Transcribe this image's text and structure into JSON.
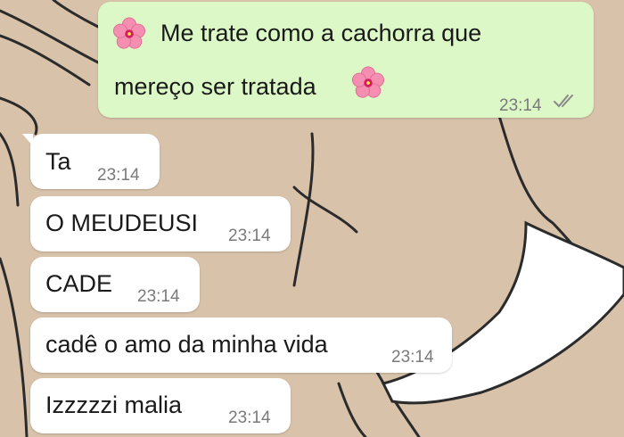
{
  "messages": [
    {
      "direction": "outgoing",
      "line1": "Me trate como a cachorra que",
      "line2": "mereço ser tratada",
      "time": "23:14",
      "status": "read-double-check-icon",
      "decoration": "cherry-blossom-icon"
    },
    {
      "direction": "incoming",
      "text": "Ta",
      "time": "23:14"
    },
    {
      "direction": "incoming",
      "text": "O MEUDEUSI",
      "time": "23:14"
    },
    {
      "direction": "incoming",
      "text": "CADE",
      "time": "23:14"
    },
    {
      "direction": "incoming",
      "text": "cadê o amo da minha vida",
      "time": "23:14"
    },
    {
      "direction": "incoming",
      "text": "Izzzzzi malia",
      "time": "23:14"
    }
  ],
  "colors": {
    "outgoing_bubble": "#dcf8c6",
    "incoming_bubble": "#ffffff",
    "wallpaper": "#d8c3aa",
    "timestamp": "#7a7a7a"
  }
}
